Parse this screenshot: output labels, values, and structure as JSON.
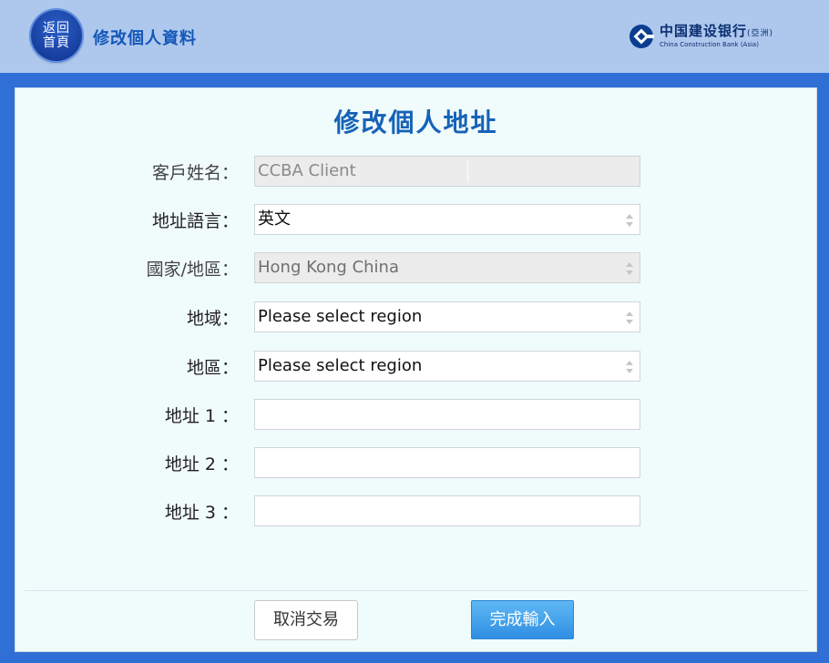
{
  "header": {
    "home_line1": "返回",
    "home_line2": "首頁",
    "title": "修改個人資料",
    "logo_cn": "中国建设银行",
    "logo_cn_suffix": "(亞洲)",
    "logo_en": "China Construction Bank (Asia)"
  },
  "form": {
    "title": "修改個人地址",
    "customer_name_label": "客戶姓名：",
    "customer_name_value": "CCBA Client",
    "address_language_label": "地址語言：",
    "address_language_value": "英文",
    "country_label": "國家/地區：",
    "country_value": "Hong Kong China",
    "territory_label": "地域：",
    "territory_value": "Please select region",
    "district_label": "地區：",
    "district_value": "Please select region",
    "address1_label": "地址 1 ：",
    "address1_value": "",
    "address2_label": "地址 2 ：",
    "address2_value": "",
    "address3_label": "地址 3 ：",
    "address3_value": ""
  },
  "buttons": {
    "cancel": "取消交易",
    "submit": "完成輸入"
  },
  "colors": {
    "header_bg": "#aec8ed",
    "page_bg": "#2f6fd6",
    "panel_bg": "#f0fbfc",
    "title_blue": "#1563b7",
    "submit_blue": "#3a97e6"
  },
  "icons": {
    "logo": "ccb-logo-icon",
    "select_arrows": "updown-arrows-icon"
  }
}
